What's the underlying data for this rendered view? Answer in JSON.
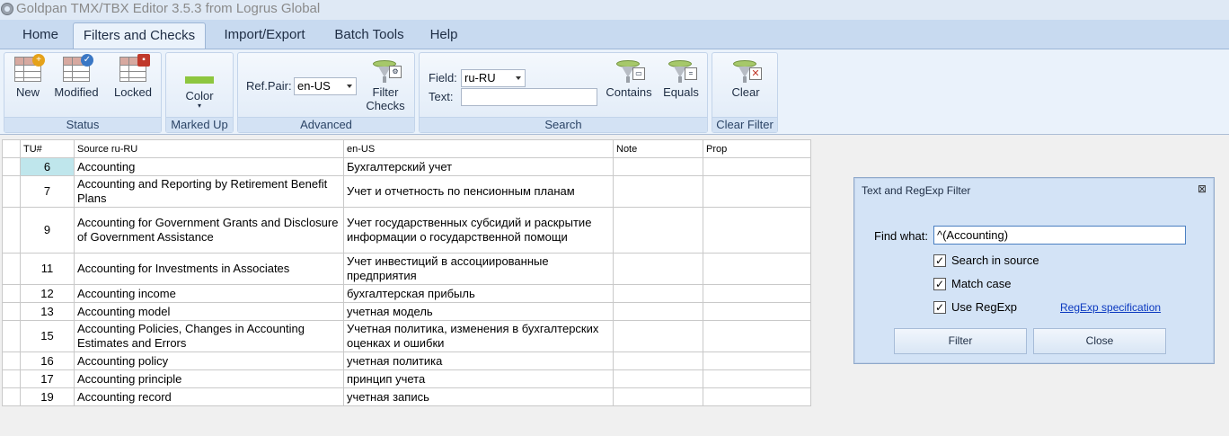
{
  "window": {
    "title": "Goldpan TMX/TBX Editor 3.5.3 from Logrus Global"
  },
  "tabs": [
    {
      "label": "Home"
    },
    {
      "label": "Filters and Checks",
      "active": true
    },
    {
      "label": "Import/Export"
    },
    {
      "label": "Batch Tools"
    },
    {
      "label": "Help"
    }
  ],
  "ribbon": {
    "status": {
      "label": "Status",
      "new": "New",
      "modified": "Modified",
      "locked": "Locked"
    },
    "marked_up": {
      "label": "Marked Up",
      "color": "Color",
      "swatch": "#8dc63f"
    },
    "advanced": {
      "label": "Advanced",
      "ref_pair_label": "Ref.Pair:",
      "ref_pair_value": "en-US",
      "filter_checks": "Filter Checks",
      "filter_checks_line1": "Filter",
      "filter_checks_line2": "Checks"
    },
    "search": {
      "label": "Search",
      "field_label": "Field:",
      "field_value": "ru-RU",
      "text_label": "Text:",
      "text_value": "",
      "contains": "Contains",
      "equals": "Equals"
    },
    "clear_filter": {
      "label": "Clear Filter",
      "clear": "Clear"
    }
  },
  "grid": {
    "headers": {
      "tu": "TU#",
      "source": "Source ru-RU",
      "target": "en-US",
      "note": "Note",
      "prop": "Prop"
    },
    "rows": [
      {
        "tu": "6",
        "source": "Accounting",
        "target": "Бухгалтерский учет",
        "selected": true
      },
      {
        "tu": "7",
        "source": "Accounting and Reporting by Retirement Benefit Plans",
        "target": "Учет и отчетность по пенсионным планам"
      },
      {
        "tu": "9",
        "source": "Accounting for Government Grants and Disclosure of Government Assistance",
        "target": "Учет государственных субсидий и раскрытие информации о государственной помощи"
      },
      {
        "tu": "11",
        "source": "Accounting for Investments in Associates",
        "target": "Учет инвестиций в ассоциированные предприятия"
      },
      {
        "tu": "12",
        "source": "Accounting income",
        "target": "бухгалтерская прибыль"
      },
      {
        "tu": "13",
        "source": "Accounting model",
        "target": "учетная модель"
      },
      {
        "tu": "15",
        "source": "Accounting Policies, Changes in Accounting Estimates and Errors",
        "target": "Учетная политика, изменения в бухгалтерских оценках и ошибки"
      },
      {
        "tu": "16",
        "source": "Accounting policy",
        "target": "учетная политика"
      },
      {
        "tu": "17",
        "source": "Accounting principle",
        "target": "принцип учета"
      },
      {
        "tu": "19",
        "source": "Accounting record",
        "target": "учетная запись"
      }
    ]
  },
  "dialog": {
    "title": "Text and RegExp Filter",
    "find_label": "Find what:",
    "find_value": "^(Accounting)",
    "search_in_source": "Search in source",
    "match_case": "Match case",
    "use_regexp": "Use RegExp",
    "regexp_link": "RegExp specification",
    "filter_button": "Filter",
    "close_button": "Close"
  }
}
